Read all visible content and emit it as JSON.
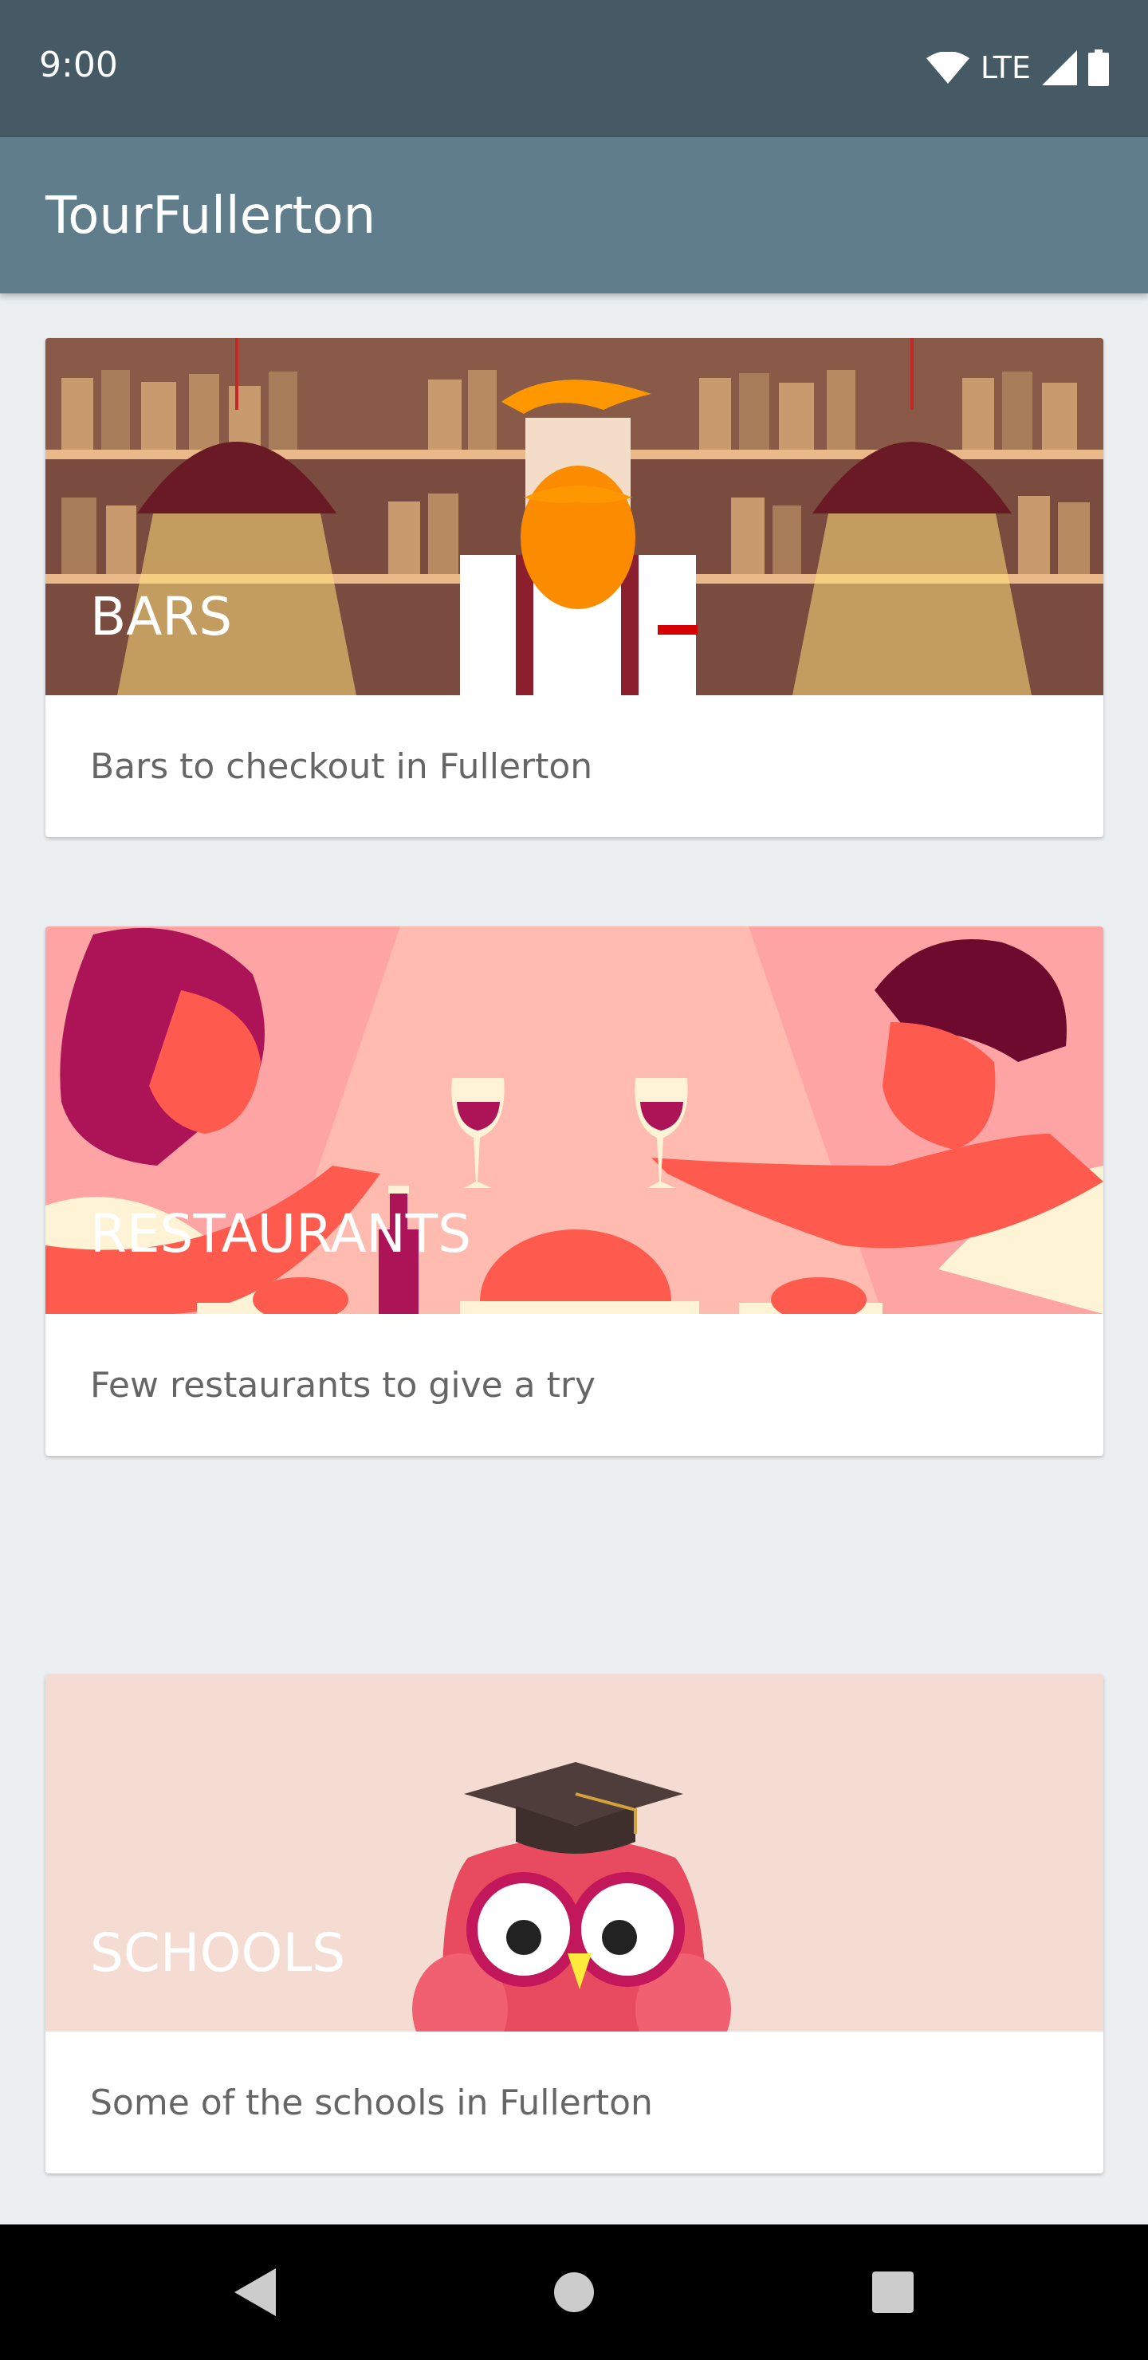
{
  "status_bar": {
    "time": "9:00",
    "network": "LTE"
  },
  "app_bar": {
    "title": "TourFullerton"
  },
  "cards": [
    {
      "title": "BARS",
      "description": "Bars to checkout in Fullerton",
      "illustration": "bartender-illustration"
    },
    {
      "title": "RESTAURANTS",
      "description": "Few restaurants to give a try",
      "illustration": "dinner-illustration"
    },
    {
      "title": "SCHOOLS",
      "description": "Some of the schools in Fullerton",
      "illustration": "owl-graduate-illustration"
    }
  ],
  "nav_bar": {
    "icons": [
      "back-icon",
      "home-icon",
      "recents-icon"
    ]
  },
  "colors": {
    "status_bar": "#455a64",
    "app_bar": "#607d8b",
    "background": "#eceff1"
  }
}
